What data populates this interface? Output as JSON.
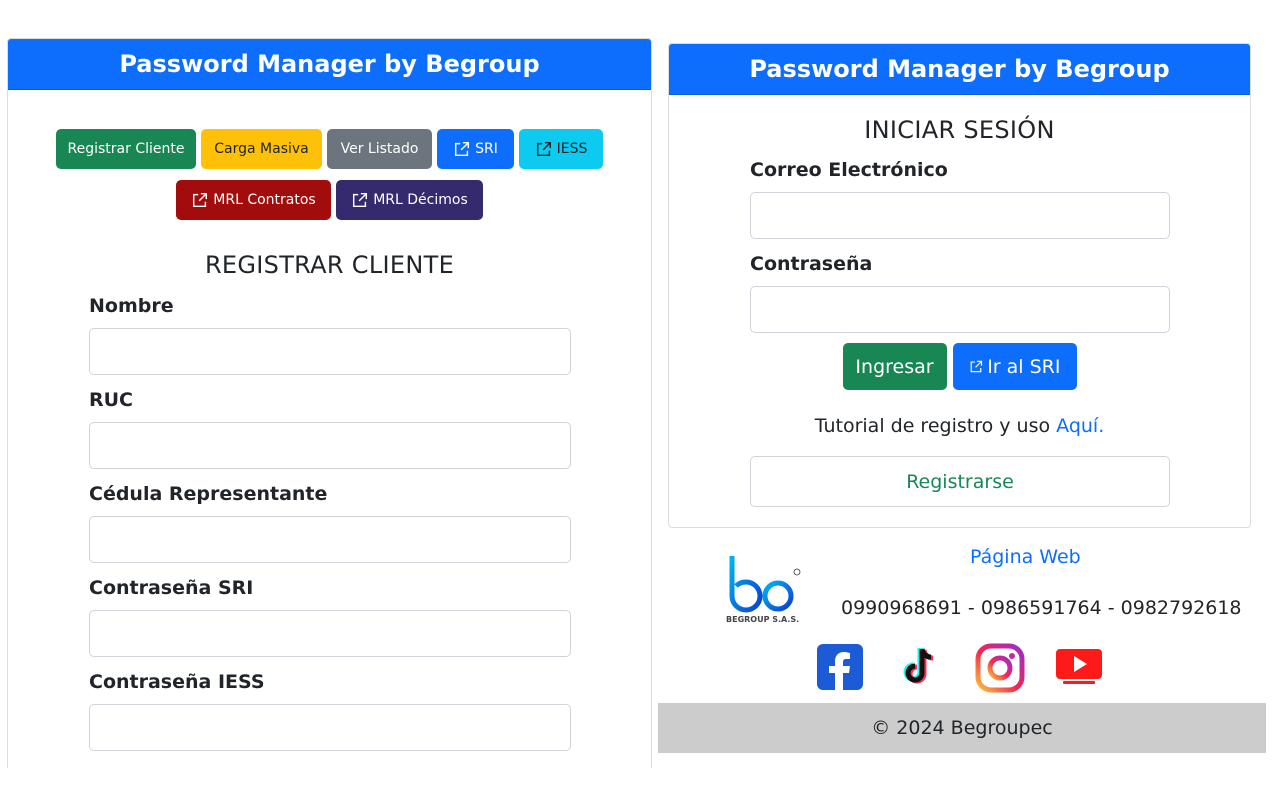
{
  "left_card": {
    "header": "Password Manager by Begroup",
    "buttons_row1": [
      "Registrar Cliente",
      "Carga Masiva",
      "Ver Listado",
      "SRI",
      "IESS"
    ],
    "buttons_row2": [
      "MRL Contratos",
      "MRL Décimos"
    ],
    "title": "REGISTRAR CLIENTE",
    "fields": [
      "Nombre",
      "RUC",
      "Cédula Representante",
      "Contraseña SRI",
      "Contraseña IESS"
    ]
  },
  "right_card": {
    "header": "Password Manager by Begroup",
    "title": "INICIAR SESIÓN",
    "email_label": "Correo Electrónico",
    "password_label": "Contraseña",
    "login_button": "Ingresar",
    "sri_button": "Ir al SRI",
    "tutorial_text": "Tutorial de registro y uso",
    "tutorial_link": "Aquí.",
    "register_button": "Registrarse"
  },
  "footer": {
    "logo_text": "BEGROUP S.A.S.",
    "website_link": "Página Web",
    "phones": "0990968691 - 0986591764 - 0982792618",
    "copyright": "© 2024 Begroupec",
    "social_icons": [
      "facebook-icon",
      "tiktok-icon",
      "instagram-icon",
      "youtube-icon"
    ]
  },
  "colors": {
    "primary": "#0d6efd",
    "success": "#198754",
    "warning": "#ffc107",
    "secondary": "#6c757d",
    "info": "#0dcaf0",
    "red": "#a30c0c",
    "purple": "#352a6e",
    "footer_bar": "#cccccc"
  }
}
